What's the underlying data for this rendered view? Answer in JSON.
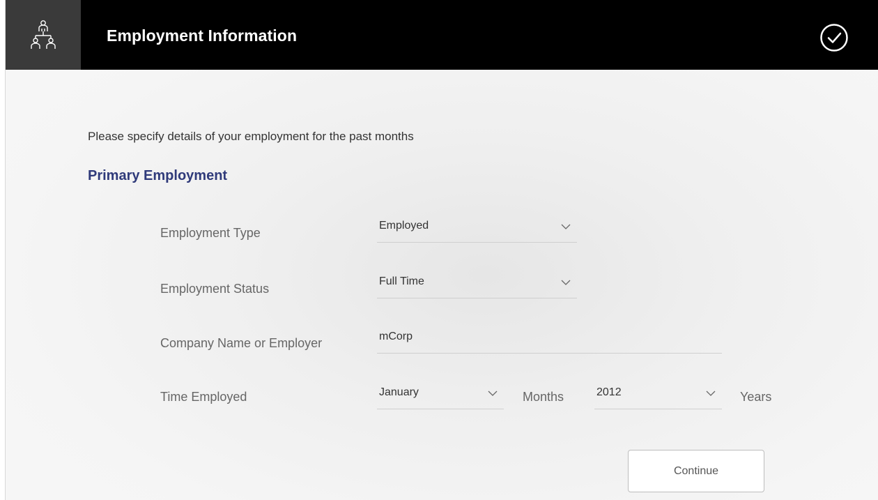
{
  "header": {
    "title": "Employment Information",
    "left_icon": "people-hierarchy-icon",
    "right_icon": "check-circle-icon"
  },
  "intro_text": "Please specify details of your employment for the past months",
  "section_title": "Primary Employment",
  "fields": {
    "employment_type": {
      "label": "Employment Type",
      "value": "Employed"
    },
    "employment_status": {
      "label": "Employment Status",
      "value": "Full Time"
    },
    "company": {
      "label": "Company Name or Employer",
      "value": "mCorp"
    },
    "time_employed": {
      "label": "Time Employed",
      "month_value": "January",
      "month_unit": "Months",
      "year_value": "2012",
      "year_unit": "Years"
    }
  },
  "continue_label": "Continue",
  "colors": {
    "header_bg": "#000000",
    "header_icon_bg": "#3a3a3a",
    "section_title": "#2f3a7a"
  }
}
